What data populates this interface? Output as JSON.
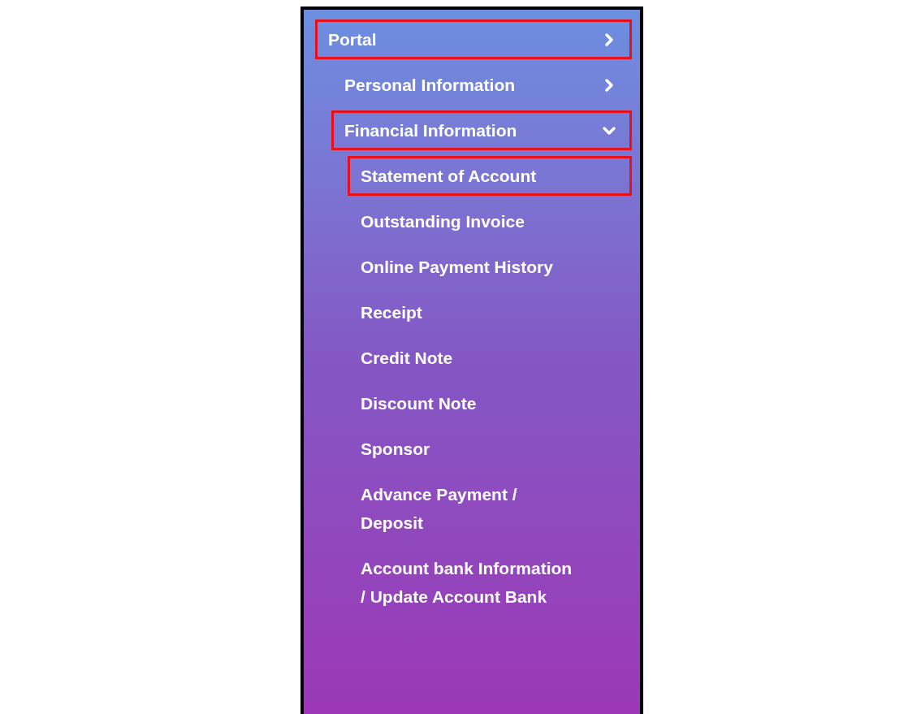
{
  "menu": {
    "items": [
      {
        "label": "Portal",
        "highlighted": true,
        "expanded": false,
        "children": [
          {
            "label": "Personal Information",
            "highlighted": false,
            "expanded": false
          },
          {
            "label": "Financial Information",
            "highlighted": true,
            "expanded": true,
            "children": [
              {
                "label": "Statement of Account",
                "highlighted": true
              },
              {
                "label": "Outstanding Invoice",
                "highlighted": false
              },
              {
                "label": "Online Payment History",
                "highlighted": false
              },
              {
                "label": "Receipt",
                "highlighted": false
              },
              {
                "label": "Credit Note",
                "highlighted": false
              },
              {
                "label": "Discount Note",
                "highlighted": false
              },
              {
                "label": "Sponsor",
                "highlighted": false
              },
              {
                "label": "Advance Payment /\nDeposit",
                "highlighted": false
              },
              {
                "label": "Account bank Information\n/ Update Account Bank",
                "highlighted": false
              }
            ]
          }
        ]
      }
    ]
  }
}
